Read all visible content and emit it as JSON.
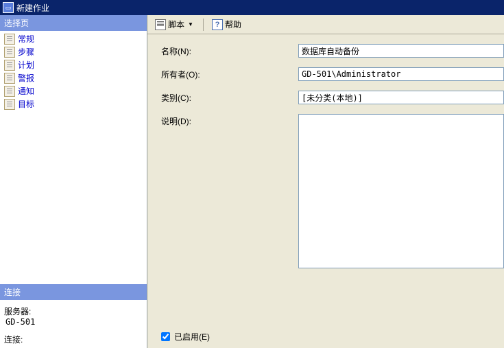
{
  "window": {
    "title": "新建作业"
  },
  "sidebar": {
    "select_header": "选择页",
    "items": [
      {
        "label": "常规"
      },
      {
        "label": "步骤"
      },
      {
        "label": "计划"
      },
      {
        "label": "警报"
      },
      {
        "label": "通知"
      },
      {
        "label": "目标"
      }
    ],
    "connection_header": "连接",
    "server_label": "服务器:",
    "server_value": "GD-501",
    "connection_label": "连接:"
  },
  "toolbar": {
    "script_label": "脚本",
    "help_label": "帮助"
  },
  "form": {
    "name_label": "名称(N):",
    "name_value": "数据库自动备份",
    "owner_label": "所有者(O):",
    "owner_value": "GD-501\\Administrator",
    "category_label": "类别(C):",
    "category_value": "[未分类(本地)]",
    "description_label": "说明(D):",
    "description_value": "",
    "enabled_label": "已启用(E)",
    "enabled_checked": true
  }
}
